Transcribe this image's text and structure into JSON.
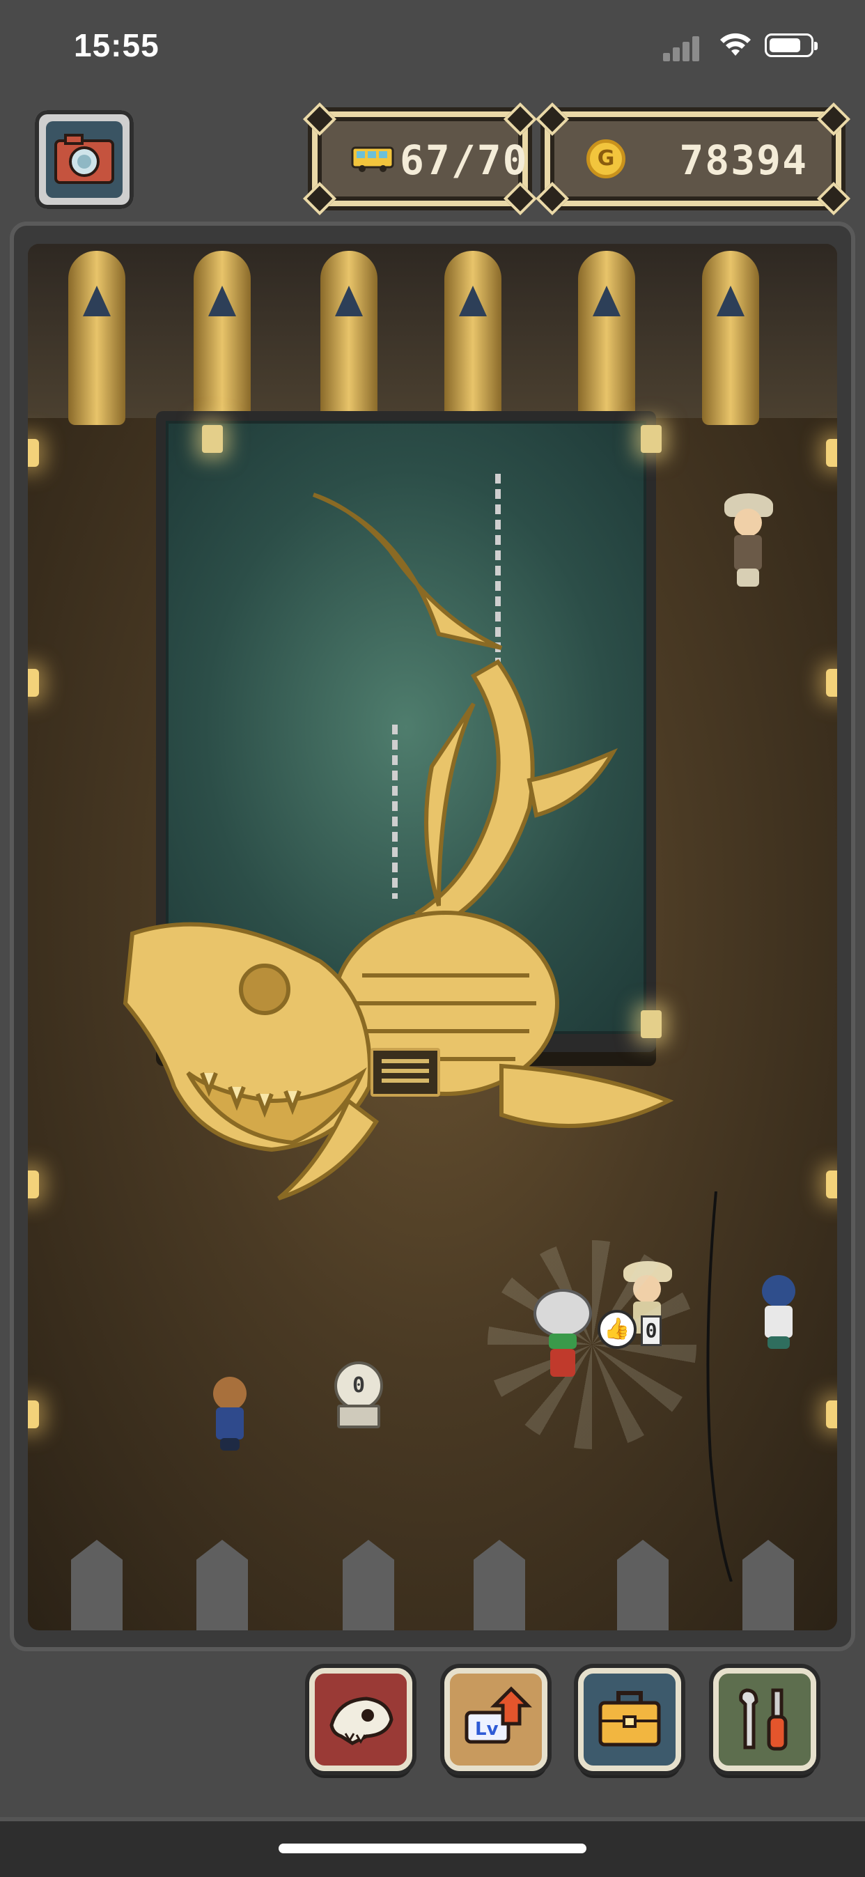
{
  "status_bar": {
    "time": "15:55"
  },
  "hud": {
    "visitors": {
      "icon": "bus-icon",
      "current": 67,
      "capacity": 70,
      "text": "67/70"
    },
    "gold": {
      "icon": "coin-icon",
      "coin_symbol": "G",
      "amount": "78394"
    }
  },
  "camera_button": {
    "icon": "camera-icon"
  },
  "exhibit": {
    "fossil": "golden-sea-serpent-skeleton",
    "plaque_icon": "plaque-icon"
  },
  "ticket_machine_label": "0",
  "mascot": {
    "bubble_icon": "thumbs-up-icon",
    "counter_label": "0"
  },
  "bottom_buttons": [
    {
      "name": "fossil-button",
      "icon": "dinosaur-skull-icon"
    },
    {
      "name": "level-up-button",
      "icon": "level-up-icon",
      "label": "Lv"
    },
    {
      "name": "shop-button",
      "icon": "briefcase-icon"
    },
    {
      "name": "tools-button",
      "icon": "wrench-screwdriver-icon"
    }
  ],
  "colors": {
    "background": "#4a4a4a",
    "gold": "#f2c53d",
    "panel_border": "#ead9a8",
    "fossil": "#e9c46a"
  }
}
